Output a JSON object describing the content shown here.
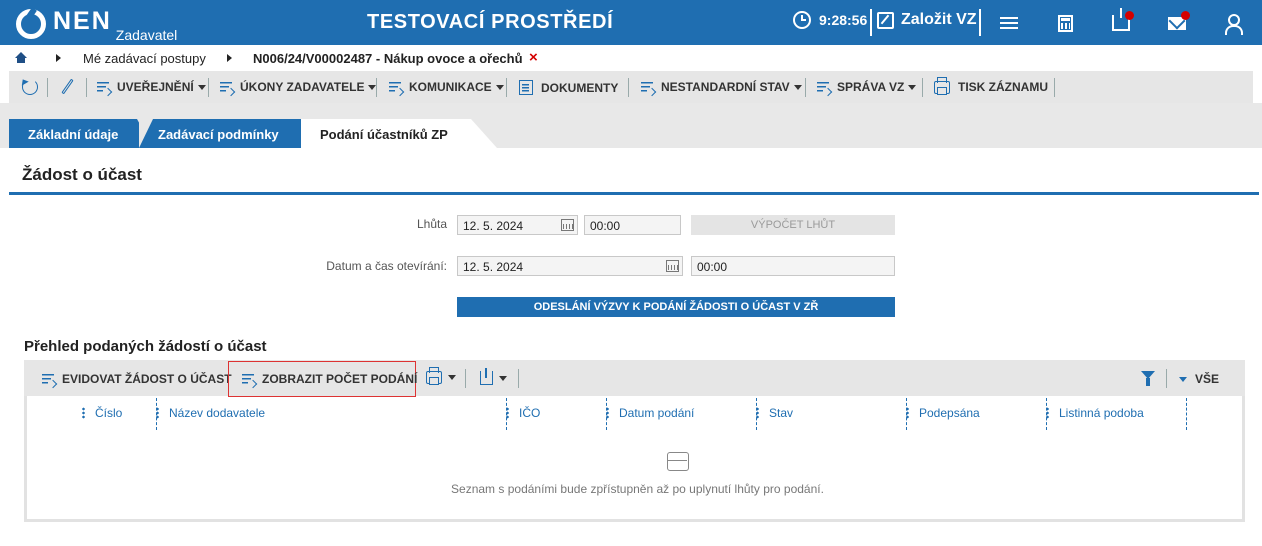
{
  "header": {
    "logo_text": "NEN",
    "logo_sub": "Zadavatel",
    "environment_title": "TESTOVACÍ PROSTŘEDÍ",
    "clock": "9:28:56",
    "create_label": "Založit VZ",
    "icons": [
      "clock-icon",
      "edit-icon",
      "menu-icon",
      "calculator-icon",
      "inbox-icon",
      "mail-icon",
      "user-icon"
    ],
    "brand_color": "#1f6eb1",
    "notification_color": "#d40000"
  },
  "breadcrumb": {
    "item1": "Mé zadávací postupy",
    "item2": "N006/24/V00002487 - Nákup ovoce a ořechů",
    "close_icon": "×"
  },
  "toolbar": {
    "uverejneni": "UVEŘEJNĚNÍ",
    "ukony": "ÚKONY ZADAVATELE",
    "komunikace": "KOMUNIKACE",
    "dokumenty": "DOKUMENTY",
    "nestandardni": "NESTANDARDNÍ STAV",
    "sprava": "SPRÁVA VZ",
    "tisk": "TISK ZÁZNAMU"
  },
  "tabs": [
    {
      "label": "Základní údaje"
    },
    {
      "label": "Zadávací podmínky"
    },
    {
      "label": "Podání účastníků ZP"
    }
  ],
  "section": {
    "title": "Žádost o účast",
    "lhuta_label": "Lhůta",
    "lhuta_date": "12. 5. 2024",
    "lhuta_time": "00:00",
    "vypocet_button": "VÝPOČET LHŮT",
    "otevirani_label": "Datum a čas otevírání:",
    "otevirani_date": "12. 5. 2024",
    "otevirani_time": "00:00",
    "odeslani_button": "ODESLÁNÍ VÝZVY K PODÁNÍ ŽÁDOSTI O ÚČAST V ZŘ"
  },
  "overview": {
    "title": "Přehled podaných žádostí o účast",
    "evidovat": "EVIDOVAT ŽÁDOST O ÚČAST",
    "zobrazit": "ZOBRAZIT POČET PODÁNÍ",
    "filter_all": "VŠE",
    "columns": [
      "Číslo",
      "Název dodavatele",
      "IČO",
      "Datum podání",
      "Stav",
      "Podepsána",
      "Listinná podoba"
    ],
    "empty_message": "Seznam s podáními bude zpřístupněn až po uplynutí lhůty pro podání."
  }
}
